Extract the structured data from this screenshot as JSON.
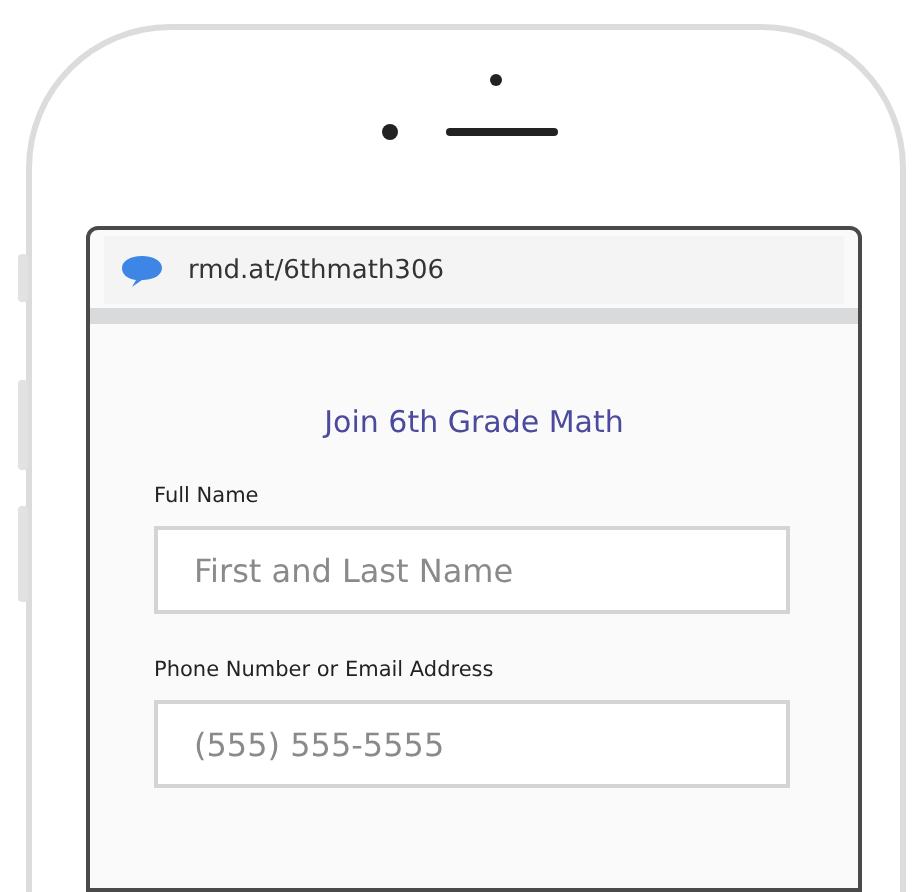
{
  "browser": {
    "url": "rmd.at/6thmath306"
  },
  "form": {
    "title": "Join 6th Grade Math",
    "fields": [
      {
        "label": "Full Name",
        "placeholder": "First and Last Name"
      },
      {
        "label": "Phone Number or Email Address",
        "placeholder": "(555) 555-5555"
      }
    ]
  }
}
